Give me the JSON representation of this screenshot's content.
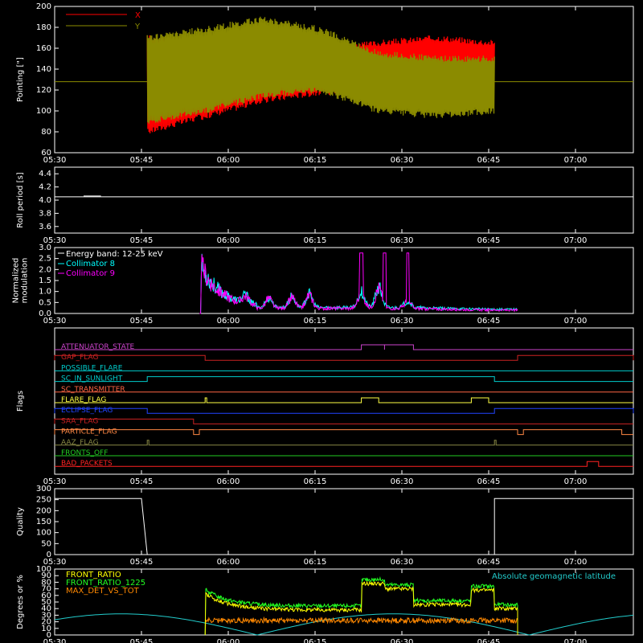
{
  "chart_data": [
    {
      "id": "pointing",
      "type": "line",
      "ylabel": "Pointing [\"]",
      "ylim": [
        60,
        200
      ],
      "yticks": [
        60,
        80,
        100,
        120,
        140,
        160,
        180,
        200
      ],
      "xlim": [
        "05:30",
        "07:10"
      ],
      "xticks": [
        "05:30",
        "05:45",
        "06:00",
        "06:15",
        "06:30",
        "06:45",
        "07:00"
      ],
      "legend_placement": "top-left",
      "reference_value": 128,
      "series": [
        {
          "name": "X",
          "color": "#ff0000",
          "data_start": "05:46",
          "data_end": "06:46",
          "envelope": [
            [
              0,
              80,
              170
            ],
            [
              10,
              95,
              165
            ],
            [
              20,
              110,
              160
            ],
            [
              30,
              118,
              158
            ],
            [
              40,
              120,
              165
            ],
            [
              50,
              125,
              170
            ],
            [
              60,
              130,
              165
            ]
          ]
        },
        {
          "name": "Y",
          "color": "#8b8b00",
          "data_start": "05:46",
          "data_end": "06:46",
          "envelope": [
            [
              0,
              90,
              170
            ],
            [
              10,
              100,
              178
            ],
            [
              20,
              115,
              188
            ],
            [
              30,
              120,
              178
            ],
            [
              40,
              100,
              155
            ],
            [
              50,
              95,
              150
            ],
            [
              60,
              100,
              150
            ]
          ]
        }
      ]
    },
    {
      "id": "roll-period",
      "type": "line",
      "ylabel": "Roll period [s]",
      "ylim": [
        3.5,
        4.5
      ],
      "yticks": [
        3.6,
        3.8,
        4.0,
        4.2,
        4.4
      ],
      "xticks": [
        "05:30",
        "05:45",
        "06:00",
        "06:15",
        "06:30",
        "06:45",
        "07:00"
      ],
      "series": [
        {
          "color": "#ffffff",
          "value": 4.05
        }
      ]
    },
    {
      "id": "modulation",
      "type": "line",
      "ylabel_lines": [
        "Normalized",
        "modulation"
      ],
      "ylim": [
        0,
        3
      ],
      "yticks": [
        0.0,
        0.5,
        1.0,
        1.5,
        2.0,
        2.5,
        3.0
      ],
      "xticks": [
        "05:30",
        "05:45",
        "06:00",
        "06:15",
        "06:30",
        "06:45",
        "07:00"
      ],
      "legend_placement": "top-left",
      "legend_title": "Energy band: 12-25 keV",
      "series": [
        {
          "name": "Collimator 8",
          "color": "#00ffff",
          "data_start": "05:55",
          "data_end": "06:50"
        },
        {
          "name": "Collimator 9",
          "color": "#ff00ff",
          "data_start": "05:55",
          "data_end": "06:50"
        }
      ]
    },
    {
      "id": "flags",
      "type": "line",
      "ylabel": "Flags",
      "xticks": [
        "05:30",
        "05:45",
        "06:00",
        "06:15",
        "06:30",
        "06:45",
        "07:00"
      ],
      "flags": [
        {
          "name": "ATTENUATOR_STATE",
          "color": "#cc44cc",
          "high": [
            [
              "06:23",
              "06:27"
            ],
            [
              "06:27",
              "06:32"
            ]
          ]
        },
        {
          "name": "GAP_FLAG",
          "color": "#cc2222",
          "high": [
            [
              "05:30",
              "05:56"
            ],
            [
              "06:50",
              "07:10"
            ]
          ]
        },
        {
          "name": "POSSIBLE_FLARE",
          "color": "#00cccc",
          "high": []
        },
        {
          "name": "SC_IN_SUNLIGHT",
          "color": "#00cccc",
          "high": [
            [
              "05:46",
              "06:46"
            ]
          ]
        },
        {
          "name": "SC_TRANSMITTER",
          "color": "#ff6644",
          "high": []
        },
        {
          "name": "FLARE_FLAG",
          "color": "#ffff44",
          "high": [
            [
              "05:56",
              "05:56"
            ],
            [
              "06:23",
              "06:26"
            ],
            [
              "06:42",
              "06:45"
            ]
          ]
        },
        {
          "name": "ECLIPSE_FLAG",
          "color": "#2244ff",
          "high": [
            [
              "05:30",
              "05:46"
            ],
            [
              "06:46",
              "07:10"
            ]
          ]
        },
        {
          "name": "SAA_FLAG",
          "color": "#cc2222",
          "high": [
            [
              "05:30",
              "05:54"
            ]
          ]
        },
        {
          "name": "PARTICLE_FLAG",
          "color": "#ff8844",
          "high": [
            [
              "05:30",
              "05:54"
            ],
            [
              "05:55",
              "06:50"
            ],
            [
              "06:51",
              "07:08"
            ]
          ]
        },
        {
          "name": "AAZ_FLAG",
          "color": "#888844",
          "high": [
            [
              "05:46",
              "05:46"
            ],
            [
              "06:46",
              "06:46"
            ]
          ]
        },
        {
          "name": "FRONTS_OFF",
          "color": "#22cc22",
          "high": []
        },
        {
          "name": "BAD_PACKETS",
          "color": "#ff2222",
          "high": [
            [
              "07:02",
              "07:04"
            ]
          ]
        }
      ]
    },
    {
      "id": "quality",
      "type": "line",
      "ylabel": "Quality",
      "ylim": [
        0,
        300
      ],
      "yticks": [
        0,
        50,
        100,
        150,
        200,
        250,
        300
      ],
      "xticks": [
        "05:30",
        "05:45",
        "06:00",
        "06:15",
        "06:30",
        "06:45",
        "07:00"
      ],
      "series": [
        {
          "color": "#ffffff",
          "points": [
            [
              "05:30",
              255
            ],
            [
              "05:45",
              255
            ],
            [
              "05:46",
              0
            ],
            [
              "06:46",
              0
            ],
            [
              "06:46",
              255
            ],
            [
              "07:10",
              255
            ]
          ]
        }
      ]
    },
    {
      "id": "ratios",
      "type": "line",
      "ylabel": "Degrees or %",
      "ylim": [
        0,
        100
      ],
      "yticks": [
        0,
        10,
        20,
        30,
        40,
        50,
        60,
        70,
        80,
        90,
        100
      ],
      "xticks": [
        "05:30",
        "05:45",
        "06:00",
        "06:15",
        "06:30",
        "06:45",
        "07:00"
      ],
      "legend_placement": "top-left",
      "annotation": "Absolute geomagnetic latitude",
      "series": [
        {
          "name": "FRONT_RATIO",
          "color": "#ffff00"
        },
        {
          "name": "FRONT_RATIO_1225",
          "color": "#22ff22"
        },
        {
          "name": "MAX_DET_VS_TOT",
          "color": "#ff8800"
        },
        {
          "name": "Absolute geomagnetic latitude",
          "color": "#22cccc"
        }
      ]
    }
  ]
}
